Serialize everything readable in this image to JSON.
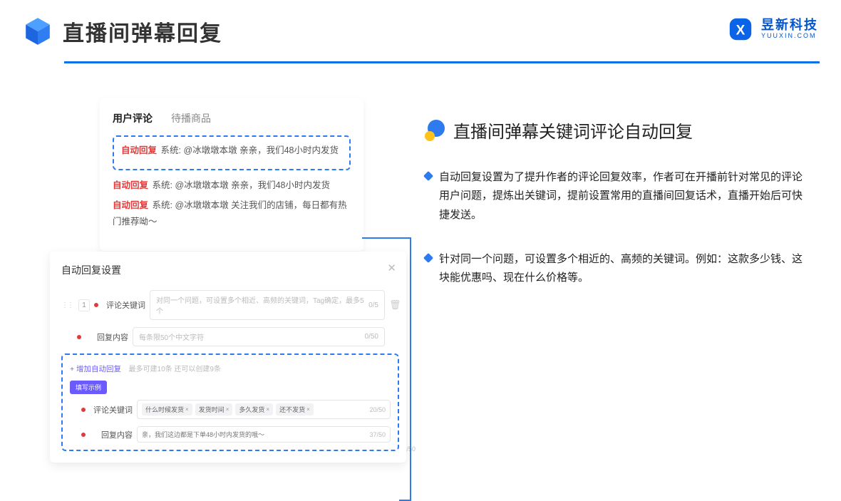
{
  "header": {
    "title": "直播间弹幕回复",
    "brand_cn": "昱新科技",
    "brand_en": "YUUXIN.COM"
  },
  "comments_card": {
    "tab_active": "用户评论",
    "tab_inactive": "待播商品",
    "highlight": {
      "tag": "自动回复",
      "text": "系统: @冰墩墩本墩 亲亲，我们48小时内发货"
    },
    "line2": {
      "tag": "自动回复",
      "text": "系统: @冰墩墩本墩 亲亲，我们48小时内发货"
    },
    "line3": {
      "tag": "自动回复",
      "text": "系统: @冰墩墩本墩 关注我们的店铺，每日都有热门推荐呦～"
    }
  },
  "settings_card": {
    "title": "自动回复设置",
    "index": "1",
    "keyword_label": "评论关键词",
    "keyword_placeholder": "对同一个问题，可设置多个相近、高频的关键词，Tag确定，最多5个",
    "keyword_count": "0/5",
    "content_label": "回复内容",
    "content_placeholder": "每条限50个中文字符",
    "content_count": "0/50",
    "add_link": "+ 增加自动回复",
    "add_note": "最多可建10条 还可以创建9条",
    "example_label": "填写示例",
    "ex_keyword_label": "评论关键词",
    "ex_tags": [
      "什么时候发货",
      "发货时间",
      "多久发货",
      "还不发货"
    ],
    "ex_keyword_count": "20/50",
    "ex_content_label": "回复内容",
    "ex_content_text": "亲，我们这边都是下单48小时内发货的哦～",
    "ex_content_count": "37/50",
    "side_count": "/50"
  },
  "right": {
    "title": "直播间弹幕关键词评论自动回复",
    "bullet1": "自动回复设置为了提升作者的评论回复效率，作者可在开播前针对常见的评论用户问题，提炼出关键词，提前设置常用的直播间回复话术，直播开始后可快捷发送。",
    "bullet2": "针对同一个问题，可设置多个相近的、高频的关键词。例如：这款多少钱、这块能优惠吗、现在什么价格等。"
  }
}
